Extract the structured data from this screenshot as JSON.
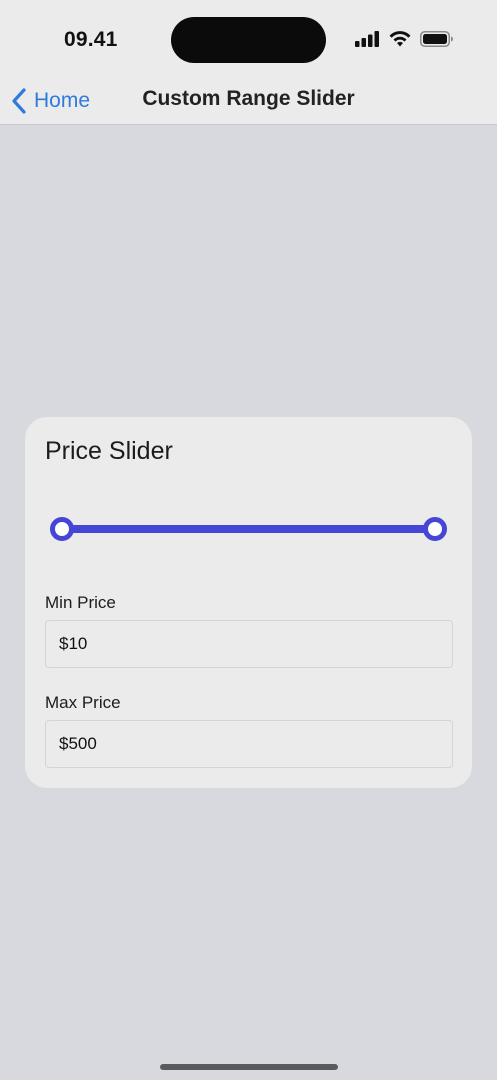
{
  "status_bar": {
    "time": "09.41",
    "icons": [
      "signal-icon",
      "wifi-icon",
      "battery-icon"
    ]
  },
  "nav": {
    "back_label": "Home",
    "title": "Custom Range Slider"
  },
  "card": {
    "title": "Price Slider",
    "slider": {
      "min_fraction": 0.0,
      "max_fraction": 1.0,
      "accent_color": "#4545d6"
    },
    "min_price": {
      "label": "Min Price",
      "value": "$10"
    },
    "max_price": {
      "label": "Max Price",
      "value": "$500"
    }
  },
  "colors": {
    "accent": "#4545d6",
    "link": "#2f7bdc",
    "background": "#d8d9de",
    "surface": "#ebebeb"
  }
}
